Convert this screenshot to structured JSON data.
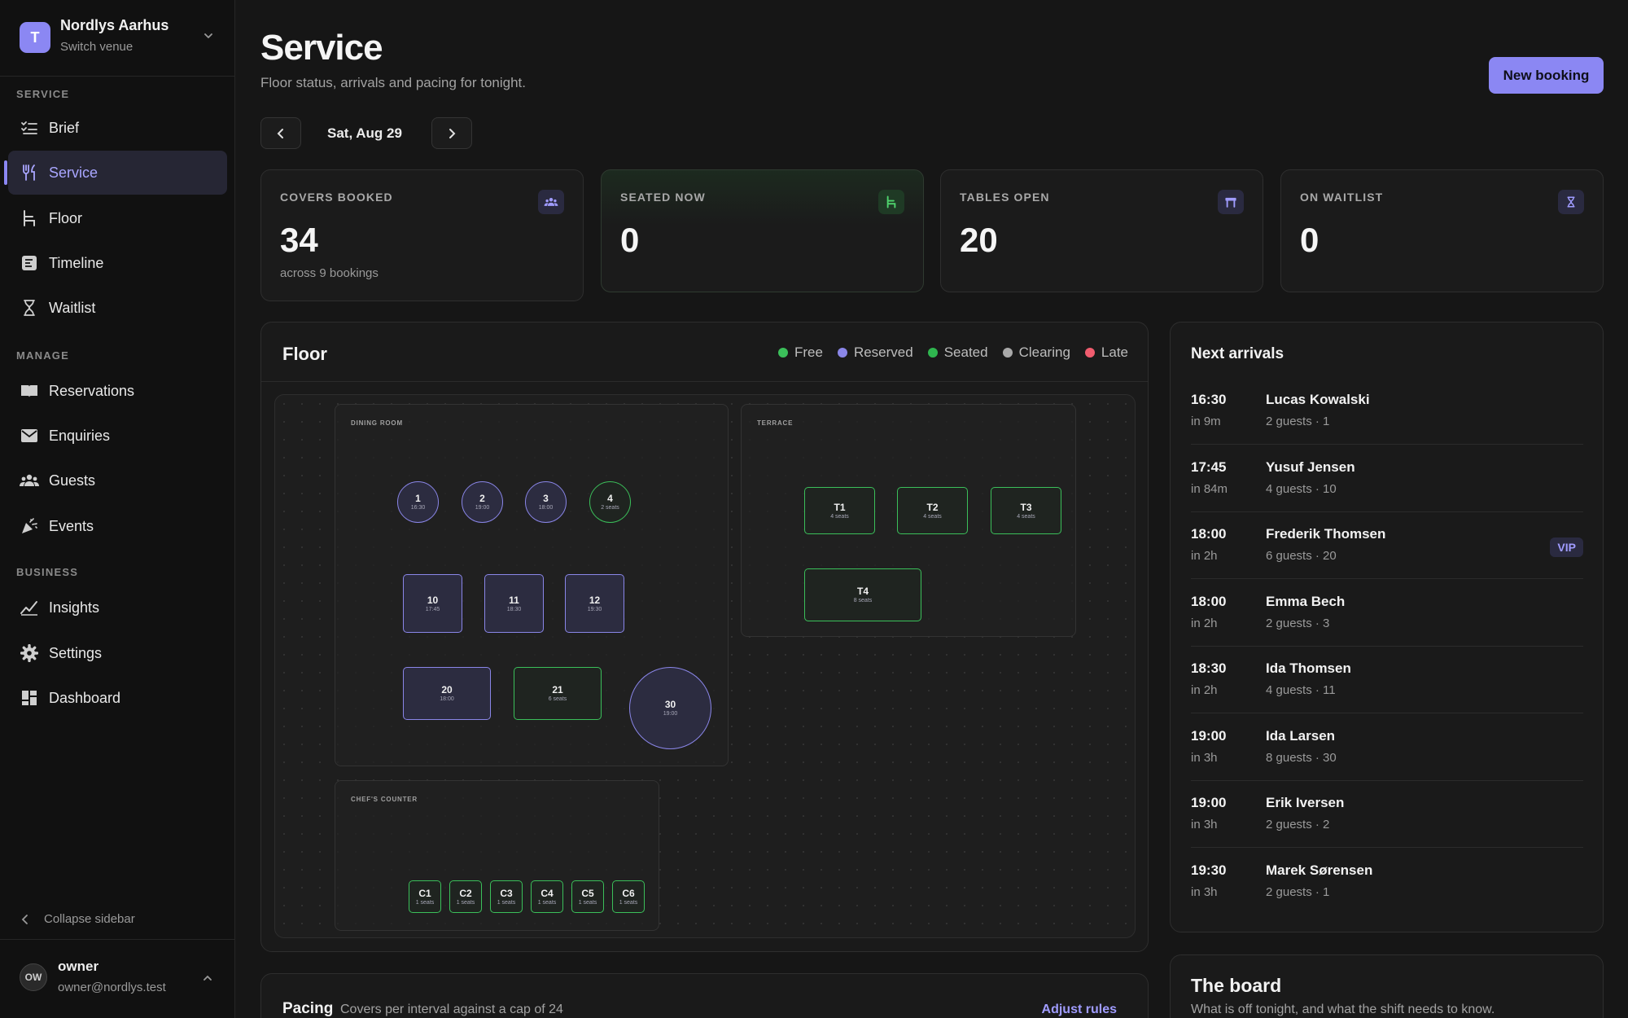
{
  "venue": {
    "initial": "T",
    "name": "Nordlys Aarhus",
    "subtitle": "Switch venue"
  },
  "sidebar": {
    "sections": [
      {
        "label": "SERVICE",
        "items": [
          {
            "label": "Brief",
            "icon": "checklist-icon"
          },
          {
            "label": "Service",
            "icon": "utensils-icon",
            "active": true
          },
          {
            "label": "Floor",
            "icon": "chair-icon"
          },
          {
            "label": "Timeline",
            "icon": "timeline-icon"
          },
          {
            "label": "Waitlist",
            "icon": "hourglass-icon"
          }
        ]
      },
      {
        "label": "MANAGE",
        "items": [
          {
            "label": "Reservations",
            "icon": "book-icon"
          },
          {
            "label": "Enquiries",
            "icon": "mail-icon"
          },
          {
            "label": "Guests",
            "icon": "users-icon"
          },
          {
            "label": "Events",
            "icon": "party-icon"
          }
        ]
      },
      {
        "label": "BUSINESS",
        "items": [
          {
            "label": "Insights",
            "icon": "chart-line-icon"
          },
          {
            "label": "Settings",
            "icon": "gear-icon"
          },
          {
            "label": "Dashboard",
            "icon": "dashboard-icon"
          }
        ]
      }
    ],
    "collapse_label": "Collapse sidebar"
  },
  "user": {
    "initials": "OW",
    "name": "owner",
    "email": "owner@nordlys.test"
  },
  "header": {
    "title": "Service",
    "subtitle": "Floor status, arrivals and pacing for tonight.",
    "new_booking": "New booking",
    "date": "Sat, Aug 29"
  },
  "stats": [
    {
      "label": "COVERS BOOKED",
      "value": "34",
      "sub": "across 9 bookings",
      "icon": "users-icon"
    },
    {
      "label": "SEATED NOW",
      "value": "0",
      "sub": "",
      "icon": "chair-icon"
    },
    {
      "label": "TABLES OPEN",
      "value": "20",
      "sub": "",
      "icon": "table-icon"
    },
    {
      "label": "ON WAITLIST",
      "value": "0",
      "sub": "",
      "icon": "hourglass-icon"
    }
  ],
  "floor": {
    "title": "Floor",
    "legend": [
      {
        "label": "Free",
        "color": "#3bbf5a"
      },
      {
        "label": "Reserved",
        "color": "#8a86e8"
      },
      {
        "label": "Seated",
        "color": "#2fb64f"
      },
      {
        "label": "Clearing",
        "color": "#a9a9a9"
      },
      {
        "label": "Late",
        "color": "#f05c6e"
      }
    ],
    "zones": {
      "dining": "DINING ROOM",
      "terrace": "TERRACE",
      "counter": "CHEF'S COUNTER"
    },
    "tables": {
      "t1": {
        "num": "1",
        "sub": "16:30"
      },
      "t2": {
        "num": "2",
        "sub": "19:00"
      },
      "t3": {
        "num": "3",
        "sub": "18:00"
      },
      "t4": {
        "num": "4",
        "sub": "2 seats"
      },
      "t10": {
        "num": "10",
        "sub": "17:45"
      },
      "t11": {
        "num": "11",
        "sub": "18:30"
      },
      "t12": {
        "num": "12",
        "sub": "19:30"
      },
      "t20": {
        "num": "20",
        "sub": "18:00"
      },
      "t21": {
        "num": "21",
        "sub": "6 seats"
      },
      "t30": {
        "num": "30",
        "sub": "19:00"
      },
      "T1": {
        "num": "T1",
        "sub": "4 seats"
      },
      "T2": {
        "num": "T2",
        "sub": "4 seats"
      },
      "T3": {
        "num": "T3",
        "sub": "4 seats"
      },
      "T4": {
        "num": "T4",
        "sub": "8 seats"
      },
      "C1": {
        "num": "C1",
        "sub": "1 seats"
      },
      "C2": {
        "num": "C2",
        "sub": "1 seats"
      },
      "C3": {
        "num": "C3",
        "sub": "1 seats"
      },
      "C4": {
        "num": "C4",
        "sub": "1 seats"
      },
      "C5": {
        "num": "C5",
        "sub": "1 seats"
      },
      "C6": {
        "num": "C6",
        "sub": "1 seats"
      }
    }
  },
  "pacing": {
    "title": "Pacing",
    "subtitle": "Covers per interval against a cap of 24",
    "link": "Adjust rules"
  },
  "arrivals": {
    "title": "Next arrivals",
    "items": [
      {
        "time": "16:30",
        "rel": "in 9m",
        "name": "Lucas Kowalski",
        "meta": "2 guests · 1",
        "badge": ""
      },
      {
        "time": "17:45",
        "rel": "in 84m",
        "name": "Yusuf Jensen",
        "meta": "4 guests · 10",
        "badge": ""
      },
      {
        "time": "18:00",
        "rel": "in 2h",
        "name": "Frederik Thomsen",
        "meta": "6 guests · 20",
        "badge": "VIP"
      },
      {
        "time": "18:00",
        "rel": "in 2h",
        "name": "Emma Bech",
        "meta": "2 guests · 3",
        "badge": ""
      },
      {
        "time": "18:30",
        "rel": "in 2h",
        "name": "Ida Thomsen",
        "meta": "4 guests · 11",
        "badge": ""
      },
      {
        "time": "19:00",
        "rel": "in 3h",
        "name": "Ida Larsen",
        "meta": "8 guests · 30",
        "badge": ""
      },
      {
        "time": "19:00",
        "rel": "in 3h",
        "name": "Erik Iversen",
        "meta": "2 guests · 2",
        "badge": ""
      },
      {
        "time": "19:30",
        "rel": "in 3h",
        "name": "Marek Sørensen",
        "meta": "2 guests · 1",
        "badge": ""
      }
    ]
  },
  "board": {
    "title": "The board",
    "subtitle": "What is off tonight, and what the shift needs to know."
  }
}
